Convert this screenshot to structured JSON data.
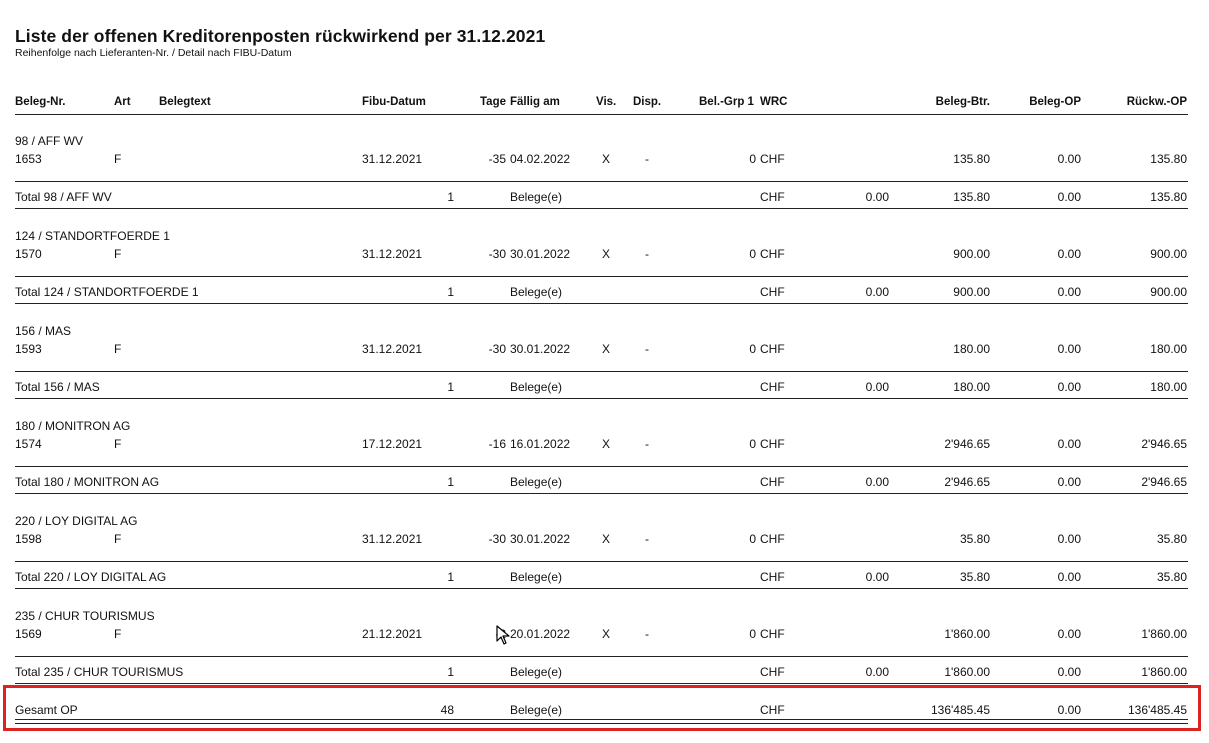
{
  "report": {
    "title": "Liste der offenen Kreditorenposten rückwirkend per 31.12.2021",
    "subtitle": "Reihenfolge nach Lieferanten-Nr. / Detail nach FIBU-Datum"
  },
  "columns": {
    "beleg_nr": "Beleg-Nr.",
    "art": "Art",
    "belegtext": "Belegtext",
    "fibu_datum": "Fibu-Datum",
    "tage": "Tage",
    "faellig_am": "Fällig am",
    "vis": "Vis.",
    "disp": "Disp.",
    "bel_grp": "Bel.-Grp 1",
    "wrc": "WRC",
    "beleg_btr": "Beleg-Btr.",
    "beleg_op": "Beleg-OP",
    "rueckw_op": "Rückw.-OP"
  },
  "groups": [
    {
      "supplier": "98 / AFF WV",
      "row": {
        "beleg_nr": "1653",
        "art": "F",
        "fibu_datum": "31.12.2021",
        "tage": "-35",
        "faellig_am": "04.02.2022",
        "vis": "X",
        "disp": "-",
        "bel_grp": "0",
        "wrc": "CHF",
        "beleg_btr": "135.80",
        "beleg_op": "0.00",
        "rueckw_op": "135.80"
      },
      "total": {
        "label": "Total 98 / AFF WV",
        "count": "1",
        "unit": "Belege(e)",
        "wrc": "CHF",
        "fw": "0.00",
        "beleg_btr": "135.80",
        "beleg_op": "0.00",
        "rueckw_op": "135.80"
      }
    },
    {
      "supplier": "124 / STANDORTFOERDE 1",
      "row": {
        "beleg_nr": "1570",
        "art": "F",
        "fibu_datum": "31.12.2021",
        "tage": "-30",
        "faellig_am": "30.01.2022",
        "vis": "X",
        "disp": "-",
        "bel_grp": "0",
        "wrc": "CHF",
        "beleg_btr": "900.00",
        "beleg_op": "0.00",
        "rueckw_op": "900.00"
      },
      "total": {
        "label": "Total 124 / STANDORTFOERDE 1",
        "count": "1",
        "unit": "Belege(e)",
        "wrc": "CHF",
        "fw": "0.00",
        "beleg_btr": "900.00",
        "beleg_op": "0.00",
        "rueckw_op": "900.00"
      }
    },
    {
      "supplier": "156 / MAS",
      "row": {
        "beleg_nr": "1593",
        "art": "F",
        "fibu_datum": "31.12.2021",
        "tage": "-30",
        "faellig_am": "30.01.2022",
        "vis": "X",
        "disp": "-",
        "bel_grp": "0",
        "wrc": "CHF",
        "beleg_btr": "180.00",
        "beleg_op": "0.00",
        "rueckw_op": "180.00"
      },
      "total": {
        "label": "Total 156 / MAS",
        "count": "1",
        "unit": "Belege(e)",
        "wrc": "CHF",
        "fw": "0.00",
        "beleg_btr": "180.00",
        "beleg_op": "0.00",
        "rueckw_op": "180.00"
      }
    },
    {
      "supplier": "180 / MONITRON AG",
      "row": {
        "beleg_nr": "1574",
        "art": "F",
        "fibu_datum": "17.12.2021",
        "tage": "-16",
        "faellig_am": "16.01.2022",
        "vis": "X",
        "disp": "-",
        "bel_grp": "0",
        "wrc": "CHF",
        "beleg_btr": "2'946.65",
        "beleg_op": "0.00",
        "rueckw_op": "2'946.65"
      },
      "total": {
        "label": "Total 180 / MONITRON AG",
        "count": "1",
        "unit": "Belege(e)",
        "wrc": "CHF",
        "fw": "0.00",
        "beleg_btr": "2'946.65",
        "beleg_op": "0.00",
        "rueckw_op": "2'946.65"
      }
    },
    {
      "supplier": "220 / LOY DIGITAL AG",
      "row": {
        "beleg_nr": "1598",
        "art": "F",
        "fibu_datum": "31.12.2021",
        "tage": "-30",
        "faellig_am": "30.01.2022",
        "vis": "X",
        "disp": "-",
        "bel_grp": "0",
        "wrc": "CHF",
        "beleg_btr": "35.80",
        "beleg_op": "0.00",
        "rueckw_op": "35.80"
      },
      "total": {
        "label": "Total 220 / LOY DIGITAL AG",
        "count": "1",
        "unit": "Belege(e)",
        "wrc": "CHF",
        "fw": "0.00",
        "beleg_btr": "35.80",
        "beleg_op": "0.00",
        "rueckw_op": "35.80"
      }
    },
    {
      "supplier": "235 / CHUR TOURISMUS",
      "row": {
        "beleg_nr": "1569",
        "art": "F",
        "fibu_datum": "21.12.2021",
        "tage": "-2",
        "faellig_am": "20.01.2022",
        "vis": "X",
        "disp": "-",
        "bel_grp": "0",
        "wrc": "CHF",
        "beleg_btr": "1'860.00",
        "beleg_op": "0.00",
        "rueckw_op": "1'860.00"
      },
      "total": {
        "label": "Total 235 / CHUR TOURISMUS",
        "count": "1",
        "unit": "Belege(e)",
        "wrc": "CHF",
        "fw": "0.00",
        "beleg_btr": "1'860.00",
        "beleg_op": "0.00",
        "rueckw_op": "1'860.00"
      }
    }
  ],
  "grand_total": {
    "label": "Gesamt OP",
    "count": "48",
    "unit": "Belege(e)",
    "wrc": "CHF",
    "beleg_btr": "136'485.45",
    "beleg_op": "0.00",
    "rueckw_op": "136'485.45"
  },
  "highlight_color": "#dd2222",
  "cursor_icon": "mouse-pointer-icon"
}
